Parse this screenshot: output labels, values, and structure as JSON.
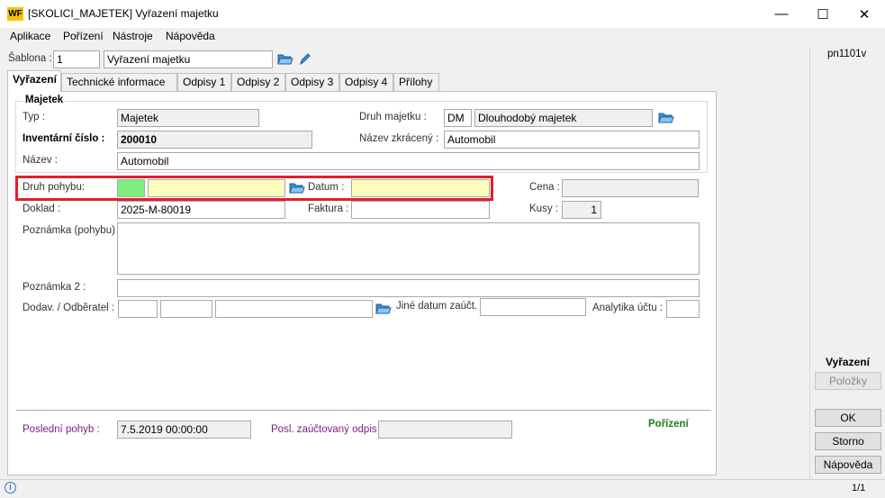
{
  "window": {
    "logo": "WF",
    "title": "[SKOLICI_MAJETEK] Vyřazení majetku",
    "minimize": "—",
    "maximize": "☐",
    "close": "✕"
  },
  "menu": [
    "Aplikace",
    "Pořízení",
    "Nástroje",
    "Nápověda"
  ],
  "template": {
    "label": "Šablona :",
    "number": "1",
    "name": "Vyřazení majetku"
  },
  "tabs": [
    "Vyřazení",
    "Technické informace",
    "Odpisy 1",
    "Odpisy 2",
    "Odpisy 3",
    "Odpisy 4",
    "Přílohy"
  ],
  "asset": {
    "group_title": "Majetek",
    "type_label": "Typ :",
    "type_value": "Majetek",
    "inventory_label": "Inventární číslo :",
    "inventory_value": "200010",
    "name_label": "Název :",
    "name_value": "Automobil",
    "kind_label": "Druh majetku :",
    "kind_code": "DM",
    "kind_name": "Dlouhodobý majetek",
    "short_name_label": "Název zkrácený :",
    "short_name_value": "Automobil"
  },
  "movement": {
    "kind_label": "Druh pohybu:",
    "kind_code": "",
    "kind_name": "",
    "date_label": "Datum :",
    "date_value": "",
    "price_label": "Cena :",
    "price_value": "",
    "doc_label": "Doklad :",
    "doc_value": "2025-M-80019",
    "invoice_label": "Faktura :",
    "invoice_value": "",
    "qty_label": "Kusy :",
    "qty_value": "1",
    "note_label": "Poznámka (pohybu) :",
    "note_value": "",
    "note2_label": "Poznámka 2 :",
    "note2_value": "",
    "partner_label": "Dodav. / Odběratel :",
    "other_date_label": "Jiné datum zaúčt.",
    "analytics_label": "Analytika účtu :"
  },
  "footer": {
    "last_move_label": "Poslední pohyb :",
    "last_move_value": "7.5.2019 00:00:00",
    "last_depr_label": "Posl. zaúčtovaný odpis :",
    "last_depr_value": "",
    "status": "Pořízení"
  },
  "right_panel": {
    "code": "pn1101v",
    "section": "Vyřazení",
    "items_btn": "Položky",
    "ok_btn": "OK",
    "cancel_btn": "Storno",
    "help_btn": "Nápověda"
  },
  "status_bar": {
    "info_icon": "i",
    "page": "1/1"
  },
  "colors": {
    "highlight_border": "#e0202a",
    "required_yellow": "#ffffc0",
    "active_green": "#80ee80",
    "status_green": "#1a7f1a",
    "footer_purple": "#7a1e7a"
  }
}
